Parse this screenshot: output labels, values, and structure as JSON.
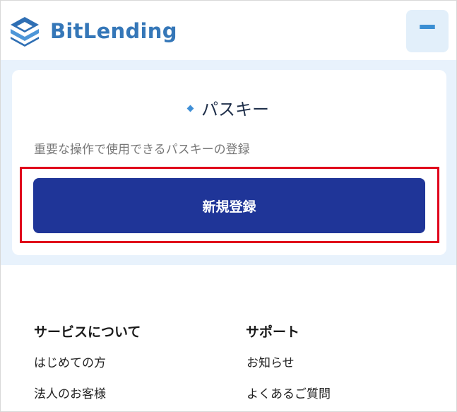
{
  "header": {
    "logo_text": "BitLending",
    "menu_icon": "hamburger-menu-icon",
    "brand_color": "#3577b8"
  },
  "passkey_card": {
    "title": "パスキー",
    "description": "重要な操作で使用できるパスキーの登録",
    "register_button_label": "新規登録",
    "button_color": "#1f3598",
    "highlight_color": "#e0001b"
  },
  "footer": {
    "columns": [
      {
        "heading": "サービスについて",
        "links": [
          "はじめての方",
          "法人のお客様"
        ]
      },
      {
        "heading": "サポート",
        "links": [
          "お知らせ",
          "よくあるご質問"
        ]
      }
    ]
  }
}
